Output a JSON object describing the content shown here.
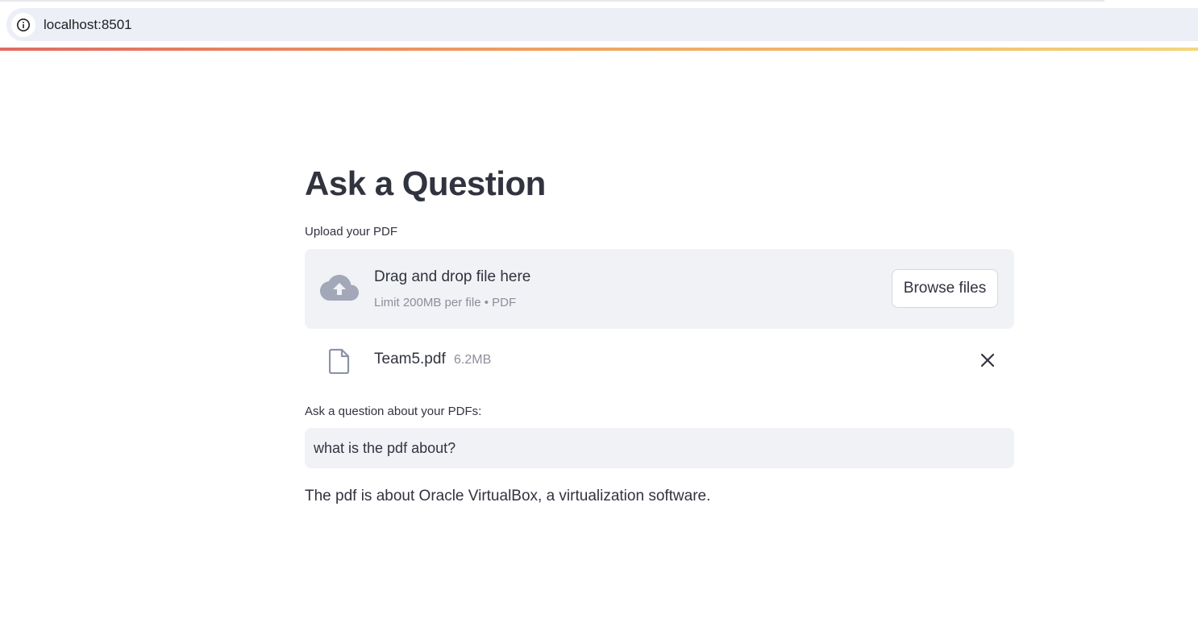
{
  "browser": {
    "url": "localhost:8501"
  },
  "page": {
    "title": "Ask a Question"
  },
  "uploader": {
    "label": "Upload your PDF",
    "drop_title": "Drag and drop file here",
    "drop_subtitle": "Limit 200MB per file • PDF",
    "browse_label": "Browse files",
    "file": {
      "name": "Team5.pdf",
      "size": "6.2MB"
    }
  },
  "question": {
    "label": "Ask a question about your PDFs:",
    "value": "what is the pdf about?"
  },
  "answer": {
    "text": "The pdf is about Oracle VirtualBox, a virtualization software."
  },
  "colors": {
    "decoration_start": "#e06b62",
    "decoration_end": "#f5d57a",
    "surface": "#f0f2f6",
    "text": "#31333f",
    "muted": "#8c8f99"
  },
  "icons": {
    "site_info": "info-circle-icon",
    "upload": "cloud-upload-icon",
    "file": "file-icon",
    "remove": "close-icon"
  }
}
